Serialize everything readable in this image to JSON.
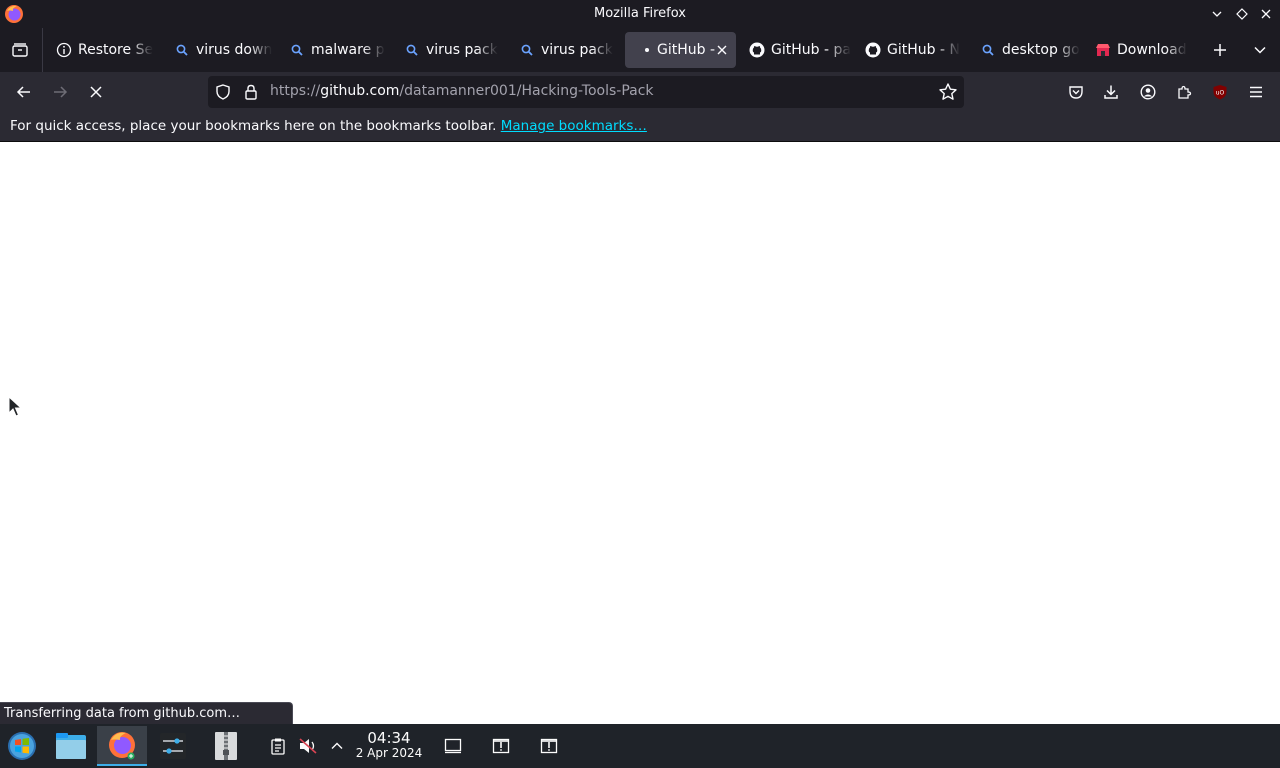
{
  "window": {
    "title": "Mozilla Firefox"
  },
  "tabs": [
    {
      "title": "Restore Se",
      "icon": "info-icon",
      "active": false
    },
    {
      "title": "virus down",
      "icon": "search-icon",
      "active": false
    },
    {
      "title": "malware p",
      "icon": "search-icon",
      "active": false
    },
    {
      "title": "virus pack",
      "icon": "search-icon",
      "active": false
    },
    {
      "title": "virus pack",
      "icon": "search-icon",
      "active": false
    },
    {
      "title": "GitHub -",
      "icon": "loading-dot-icon",
      "active": true
    },
    {
      "title": "GitHub - pa",
      "icon": "github-icon",
      "active": false
    },
    {
      "title": "GitHub - N",
      "icon": "github-icon",
      "active": false
    },
    {
      "title": "desktop go",
      "icon": "search-icon",
      "active": false
    },
    {
      "title": "Download",
      "icon": "store-icon",
      "active": false
    }
  ],
  "urlbar": {
    "prefix": "https://",
    "host": "github.com",
    "path": "/datamanner001/Hacking-Tools-Pack"
  },
  "bookmarks_bar": {
    "message": "For quick access, place your bookmarks here on the bookmarks toolbar.",
    "link": "Manage bookmarks…"
  },
  "status": {
    "text": "Transferring data from github.com…"
  },
  "taskbar": {
    "time": "04:34",
    "date": "2 Apr 2024"
  },
  "colors": {
    "chrome_dark": "#1c1b22",
    "toolbar": "#2b2a33",
    "active_tab": "#42414d",
    "link": "#00ddff",
    "taskbar": "#1f2329",
    "accent": "#3daee9"
  }
}
